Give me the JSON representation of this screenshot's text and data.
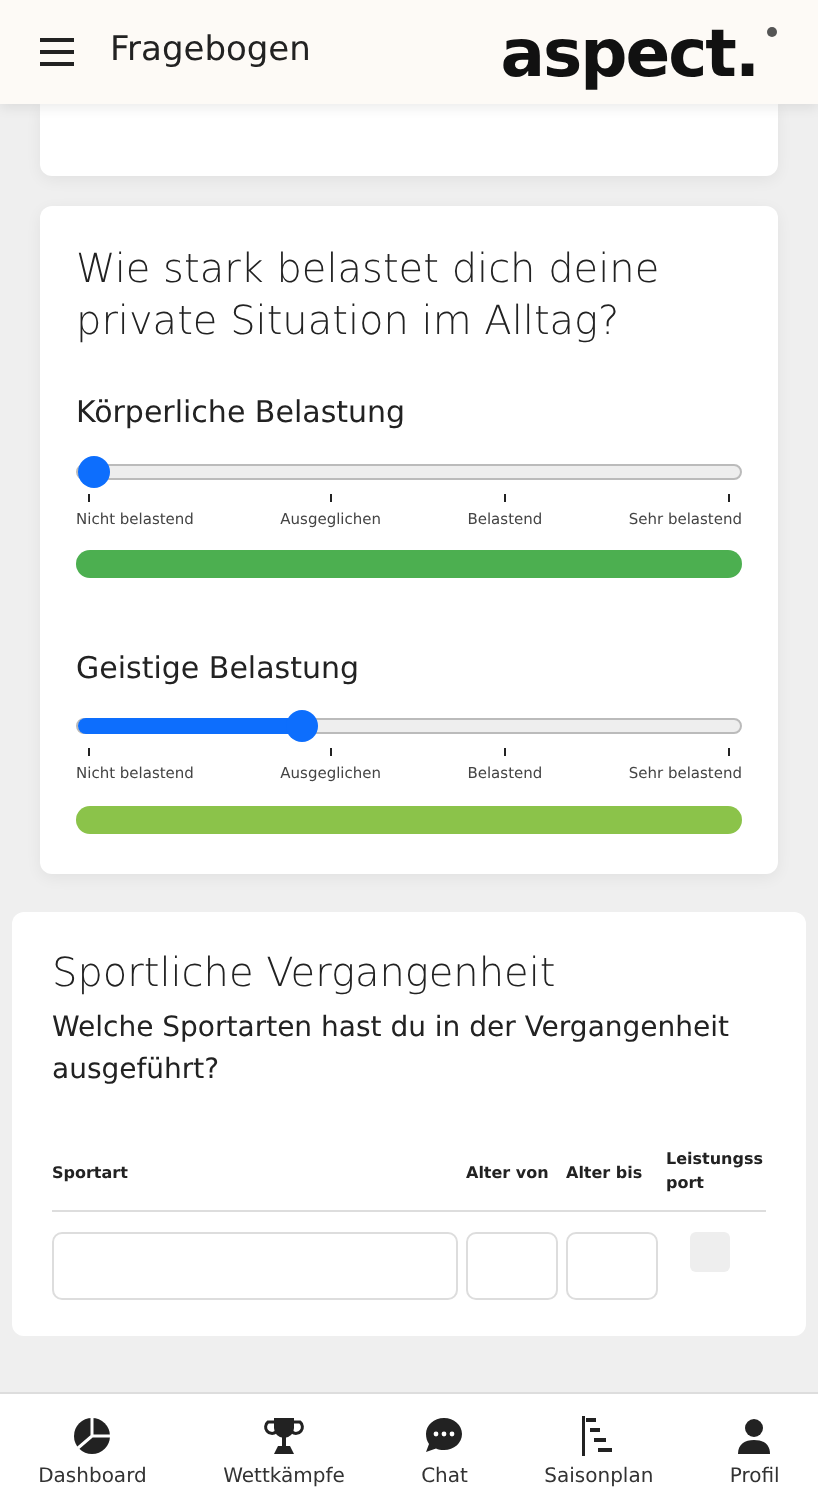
{
  "header": {
    "title": "Fragebogen",
    "logo": "aspect."
  },
  "question_card": {
    "question": "Wie stark belastet dich deine private Situation im Alltag?",
    "scales": [
      {
        "label": "Körperliche Belastung",
        "level": 0,
        "color": "#4caf50",
        "ticks": [
          "Nicht belastend",
          "Ausgeglichen",
          "Belastend",
          "Sehr belastend"
        ]
      },
      {
        "label": "Geistige Belastung",
        "level": 0.33,
        "color": "#8bc34a",
        "ticks": [
          "Nicht belastend",
          "Ausgeglichen",
          "Belastend",
          "Sehr belastend"
        ]
      }
    ]
  },
  "history_card": {
    "title": "Sportliche Vergangenheit",
    "question": "Welche Sportarten hast du in der Vergangenheit ausgeführt?",
    "table": {
      "columns": [
        "Sportart",
        "Alter von",
        "Alter bis",
        "Leistungssport"
      ],
      "rows": [
        {
          "competitive": false
        }
      ]
    }
  },
  "bottom_nav": [
    {
      "label": "Dashboard",
      "selected": false
    },
    {
      "label": "Wettkämpfe",
      "selected": false
    },
    {
      "label": "Chat",
      "selected": false
    },
    {
      "label": "Saisonplan",
      "selected": false
    },
    {
      "label": "Profil",
      "selected": false
    }
  ]
}
